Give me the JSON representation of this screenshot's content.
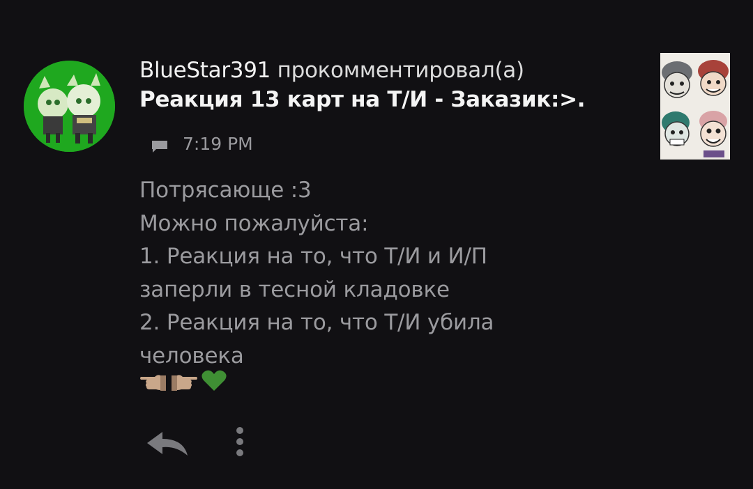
{
  "notification": {
    "username": "BlueStar391",
    "action": "прокомментировал(а)",
    "post_title": "Реакция 13 карт на Т/И - Заказик:>.",
    "time": "7:19 PM",
    "comment_lines": [
      "Потрясающе :3",
      "Можно пожалуйста:",
      "1. Реакция на то, что Т/И и И/П",
      "заперли в тесной кладовке",
      "2. Реакция на то, что Т/И убила",
      "человека"
    ],
    "emojis": [
      "pointing-left-hand-icon",
      "pointing-right-hand-icon",
      "green-heart-icon"
    ]
  },
  "colors": {
    "background": "#111013",
    "avatar_bg": "#1fa81f",
    "secondary_text": "#9b9b9f",
    "heart": "#3f8f34"
  }
}
